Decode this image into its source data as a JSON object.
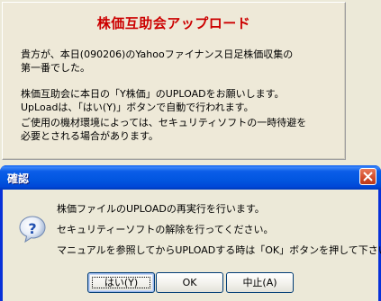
{
  "page": {
    "title": "株価互助会アップロード",
    "paragraph1": "貴方が、本日(090206)のYahooファイナンス日足株価収集の\n第一番でした。",
    "paragraph2": "株価互助会に本日の「Y株価」のUPLOADをお願いします。\nUpLoadは、「はい(Y)」ボタンで自動で行われます。",
    "paragraph3": "ご使用の機材環境によっては、セキュリティソフトの一時待避を\n必要とされる場合があります。"
  },
  "dialog": {
    "title": "確認",
    "icon": "question-icon",
    "messages": [
      "株価ファイルのUPLOADの再実行を行います。",
      "セキュリティーソフトの解除を行ってください。",
      "マニュアルを参照してからUPLOADする時は「OK」ボタンを押して下さい。"
    ],
    "buttons": {
      "yes": "はい(Y)",
      "ok": "OK",
      "cancel": "中止(A)"
    }
  }
}
